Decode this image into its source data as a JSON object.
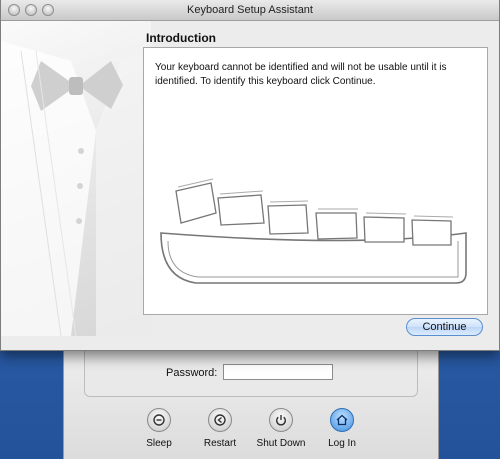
{
  "window": {
    "title": "Keyboard Setup Assistant"
  },
  "section": {
    "title": "Introduction",
    "message": "Your keyboard cannot be identified and will not be usable until it is identified. To identify this keyboard click Continue."
  },
  "buttons": {
    "continue_label": "Continue"
  },
  "login": {
    "password_label": "Password:",
    "password_value": "",
    "actions": [
      {
        "label": "Sleep",
        "icon": "sleep-icon"
      },
      {
        "label": "Restart",
        "icon": "restart-icon"
      },
      {
        "label": "Shut Down",
        "icon": "power-icon"
      },
      {
        "label": "Log In",
        "icon": "home-icon"
      }
    ]
  },
  "colors": {
    "desktop": "#2f63b0",
    "window_bg": "#ececec",
    "accent_button": "#5b8fd0"
  }
}
